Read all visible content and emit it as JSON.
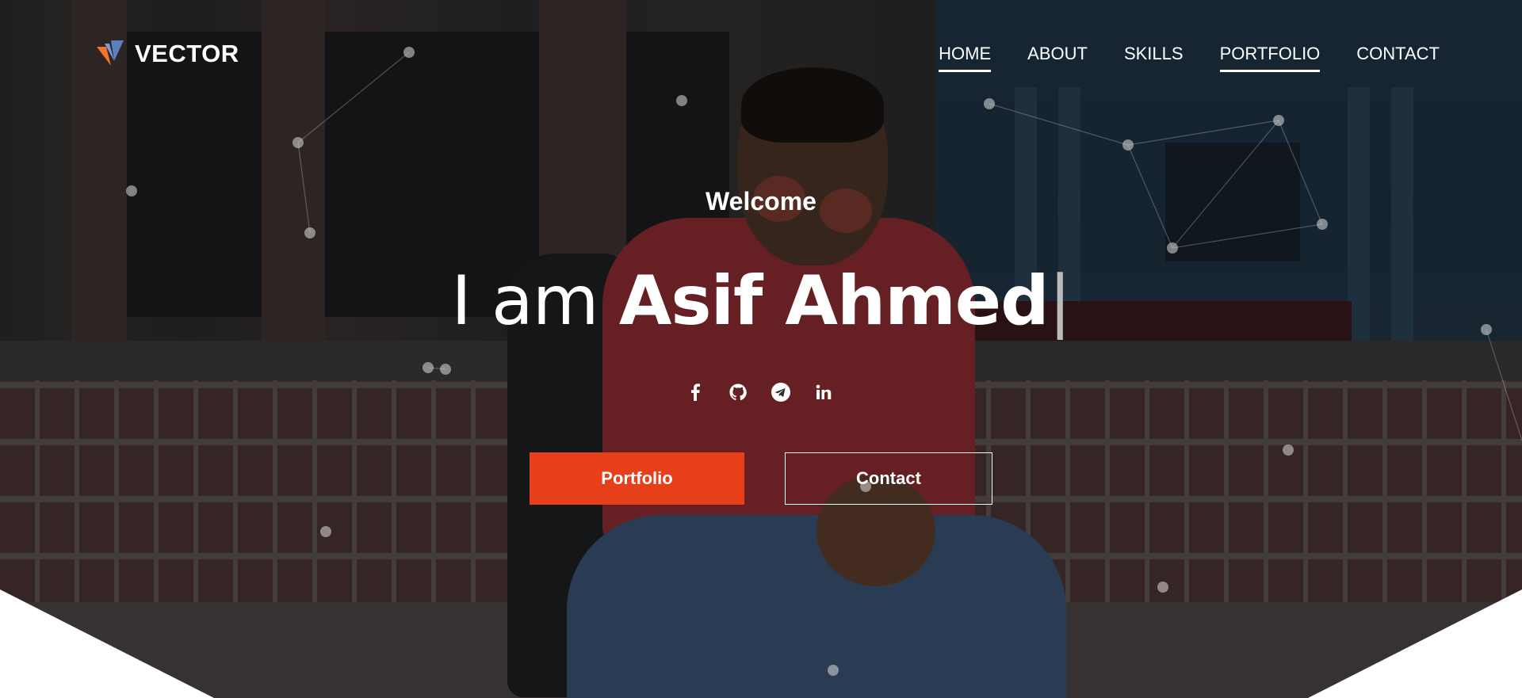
{
  "brand": {
    "name": "VECTOR",
    "accent": "#e63f1a",
    "logo_colors": [
      "#f2732a",
      "#7a9fd8"
    ]
  },
  "nav": {
    "items": [
      {
        "label": "HOME",
        "active": true
      },
      {
        "label": "ABOUT",
        "active": false
      },
      {
        "label": "SKILLS",
        "active": false
      },
      {
        "label": "PORTFOLIO",
        "active": true
      },
      {
        "label": "CONTACT",
        "active": false
      }
    ]
  },
  "hero": {
    "welcome": "Welcome",
    "intro": "I am ",
    "name": "Asif Ahmed",
    "cursor": "|",
    "socials": [
      "facebook-icon",
      "github-icon",
      "telegram-icon",
      "linkedin-icon"
    ],
    "buttons": {
      "primary": "Portfolio",
      "secondary": "Contact"
    }
  }
}
